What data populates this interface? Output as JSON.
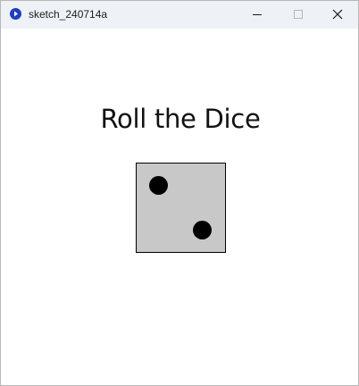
{
  "window": {
    "title": "sketch_240714a",
    "icon": "processing-app-icon",
    "controls": [
      "minimize-icon",
      "maximize-icon",
      "close-icon"
    ]
  },
  "canvas": {
    "heading": "Roll the Dice",
    "die": {
      "face_value": 2,
      "face_color": "#c8c8c8",
      "pip_color": "#000000"
    }
  }
}
